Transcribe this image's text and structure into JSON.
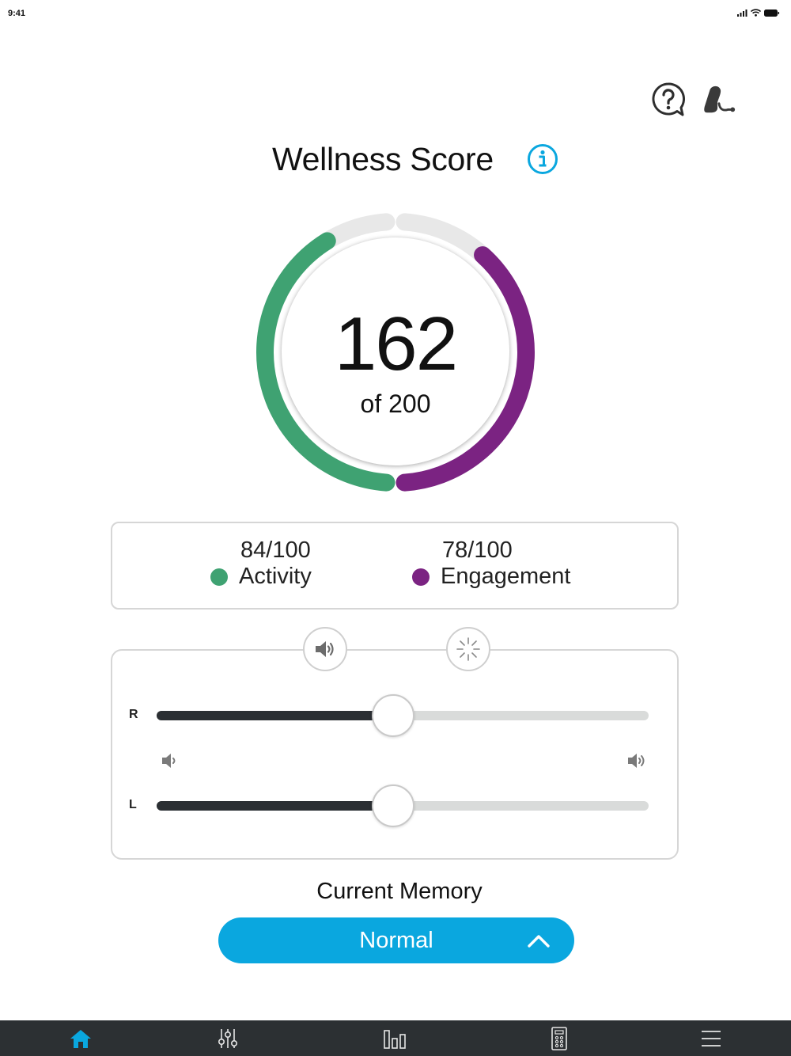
{
  "status_bar": {
    "time": "9:41"
  },
  "header": {
    "help_icon": "help-bubble-icon",
    "device_icon": "hearing-aid-icon"
  },
  "wellness": {
    "title": "Wellness Score",
    "info_icon": "info-icon",
    "score": "162",
    "score_sub": "of 200",
    "total": 200,
    "activity_fraction": 0.84,
    "engagement_fraction": 0.78,
    "colors": {
      "activity": "#3fa272",
      "engagement": "#7b2382",
      "track": "#e8e8e8"
    }
  },
  "stats": {
    "activity": {
      "value": "84/100",
      "label": "Activity"
    },
    "engagement": {
      "value": "78/100",
      "label": "Engagement"
    }
  },
  "volume": {
    "mode_buttons": [
      "volume-icon",
      "ambient-icon"
    ],
    "right": {
      "label": "R",
      "level": 0.48
    },
    "left": {
      "label": "L",
      "level": 0.48
    },
    "min_icon": "volume-low-icon",
    "max_icon": "volume-high-icon"
  },
  "memory": {
    "label": "Current Memory",
    "value": "Normal",
    "accent": "#0aa7df"
  },
  "tabs": [
    {
      "name": "home",
      "icon": "home-icon",
      "active": true
    },
    {
      "name": "adjust",
      "icon": "sliders-icon",
      "active": false
    },
    {
      "name": "stats",
      "icon": "bar-chart-icon",
      "active": false
    },
    {
      "name": "remote",
      "icon": "remote-icon",
      "active": false
    },
    {
      "name": "menu",
      "icon": "menu-icon",
      "active": false
    }
  ]
}
